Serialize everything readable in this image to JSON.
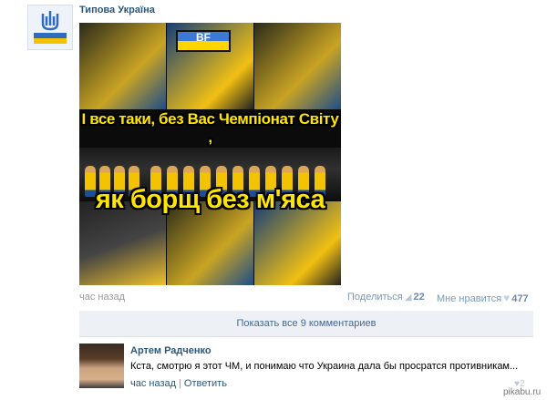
{
  "post": {
    "group_name": "Типова Україна",
    "avatar_text": "ТИПОВА УКРАЇНА",
    "image": {
      "banner_text": "BF",
      "caption_top": "І все таки, без Вас Чемпіонат Світу ,",
      "caption_bottom": "як борщ без м'яса"
    },
    "time": "час назад",
    "share_label": "Поделиться",
    "share_count": "22",
    "like_label": "Мне нравится",
    "like_count": "477"
  },
  "comments": {
    "show_all_label": "Показать все 9 комментариев",
    "items": [
      {
        "author": "Артем Радченко",
        "text": "Кста, смотрю я этот ЧМ, и понимаю что Украина дала бы просратся противникам...",
        "time": "час назад",
        "reply_label": "Ответить",
        "likes": "2"
      }
    ]
  },
  "watermark": "pikabu.ru"
}
